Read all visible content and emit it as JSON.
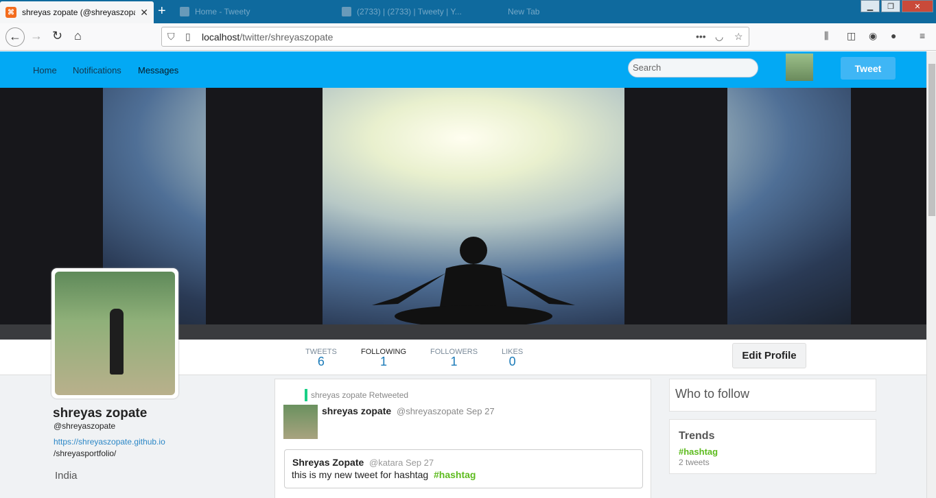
{
  "browser": {
    "active_tab_title": "shreyas zopate (@shreyaszopate",
    "bg_tabs": [
      "Home - Tweety",
      "(2733) | (2733) | Tweety | Y...",
      "New Tab"
    ],
    "url_host": "localhost",
    "url_path": "/twitter/shreyaszopate"
  },
  "topnav": {
    "home": "Home",
    "notifications": "Notifications",
    "messages": "Messages",
    "search_placeholder": "Search",
    "tweet_button": "Tweet"
  },
  "stats": [
    {
      "label": "TWEETS",
      "value": "6"
    },
    {
      "label": "FOLLOWING",
      "value": "1"
    },
    {
      "label": "FOLLOWERS",
      "value": "1"
    },
    {
      "label": "LIKES",
      "value": "0"
    }
  ],
  "edit_profile": "Edit Profile",
  "profile": {
    "name": "shreyas zopate",
    "handle": "@shreyaszopate",
    "link": "https://shreyaszopate.github.io",
    "link_suffix": "/shreyasportfolio/",
    "location": "India"
  },
  "feed": {
    "retweet_label": "shreyas zopate Retweeted",
    "author": "shreyas zopate",
    "meta": "@shreyaszopate Sep 27",
    "quote_author": "Shreyas Zopate",
    "quote_meta": "@katara Sep 27",
    "quote_text": "this is my new tweet for hashtag",
    "quote_hashtag": "#hashtag"
  },
  "sidebar": {
    "who_to_follow": "Who to follow",
    "trends_title": "Trends",
    "trend_tag": "#hashtag",
    "trend_count": "2 tweets"
  }
}
